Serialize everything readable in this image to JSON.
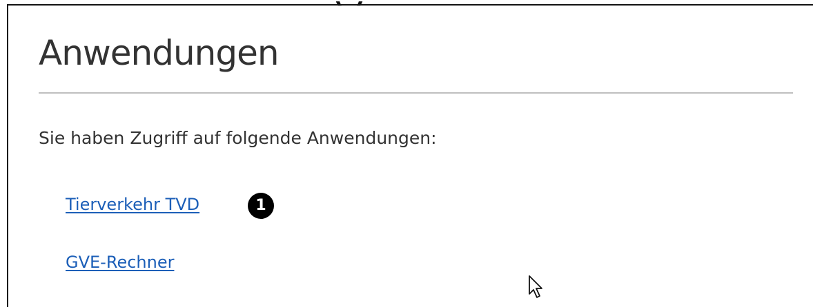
{
  "page": {
    "title": "Anwendungen",
    "intro": "Sie haben Zugriff auf folgende Anwendungen:"
  },
  "applications": [
    {
      "label": "Tierverkehr TVD",
      "marker": "1"
    },
    {
      "label": "GVE-Rechner"
    }
  ],
  "colors": {
    "link": "#1c5fb8",
    "heading": "#333333",
    "rule": "#bfbfbf"
  },
  "icons": {
    "cursor": "mouse-pointer-icon"
  }
}
